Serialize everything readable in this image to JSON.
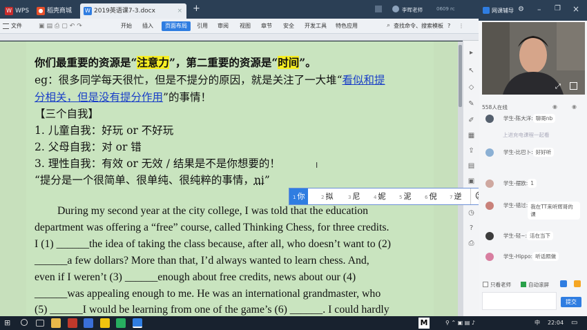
{
  "app": {
    "tabs": [
      {
        "label": "WPS",
        "icon": "wps-icon"
      },
      {
        "label": "稻壳商城",
        "icon": "daoke-icon"
      },
      {
        "label": "2019英语课7-3.docx",
        "icon": "doc-icon"
      }
    ],
    "new_tab": "+",
    "user": "李晖老师",
    "user_extra": "0609 rc"
  },
  "ribbon": {
    "file": "文件",
    "menus": [
      "开始",
      "插入",
      "页面布局",
      "引用",
      "审阅",
      "视图",
      "章节",
      "安全",
      "开发工具",
      "特色应用"
    ],
    "active_menu": "页面布局",
    "search": "查找命令、搜索模板",
    "help": "?"
  },
  "document": {
    "line1_a": "你们最重要的资源是“",
    "line1_hl1": "注意力",
    "line1_b": "”，第二重要的资源是“",
    "line1_hl2": "时间",
    "line1_c": "”。",
    "line2_a": "eg：很多同学每天很忙，但是不提分的原因，就是关注了一大堆“",
    "line2_link": "看似和提",
    "line3_link": "分相关，但是没有提分作用",
    "line3_b": "”的事情！",
    "line4": "【三个自我】",
    "line5": "1.  儿童自我：好玩 or 不好玩",
    "line6": "2.  父母自我：对 or 错",
    "line7": "3.  理性自我：有效 or 无效 / 结果是不是你想要的！",
    "line8_a": "“提分是一个很简单、很单纯、很纯粹的事情，",
    "line8_typing": "ni",
    "line8_b": "”",
    "para": [
      "During my second year at the city college, I was told that the education",
      "department was offering a “free” course, called Thinking Chess, for three credits.",
      "I (1) ______the idea of taking the class because, after all, who doesn’t want to (2)",
      "______a few dollars? More than that, I’d always wanted to learn chess. And,",
      "even if I weren’t (3) ______enough about free credits, news about our (4)",
      "______was appealing enough to me. He was an international grandmaster, who",
      "(5) ______I would be learning from one of the game’s (6) ______. I could hardly"
    ]
  },
  "ime": {
    "candidates": [
      {
        "n": "1",
        "c": "你"
      },
      {
        "n": "2",
        "c": "拟"
      },
      {
        "n": "3",
        "c": "尼"
      },
      {
        "n": "4",
        "c": "妮"
      },
      {
        "n": "5",
        "c": "泥"
      },
      {
        "n": "6",
        "c": "倪"
      },
      {
        "n": "7",
        "c": "逆"
      }
    ],
    "emoji": "☺"
  },
  "panel": {
    "title": "网课辅导",
    "online": "558人在线",
    "messages": [
      {
        "who": "学生-陈大洋:",
        "text": "聊哥nb"
      },
      {
        "who": "",
        "text": "上进充电课程一起看"
      },
      {
        "who": "学生-比巴卜:",
        "text": "好好听"
      },
      {
        "who": "学生-摆欧:",
        "text": "1"
      },
      {
        "who": "学生-错过:",
        "text": "我在TT来听辉哥的课"
      },
      {
        "who": "学生-轻~:",
        "text": "活在当下"
      },
      {
        "who": "学生-Hippo:",
        "text": "听话照做"
      }
    ],
    "only_teacher": "只看老师",
    "auto_scroll": "自动滚屏",
    "send": "提交"
  },
  "taskbar": {
    "lang": "中",
    "time": "22:04",
    "m": "M"
  },
  "colors": {
    "accent": "#2f7de1",
    "doc_bg": "#c9e4bf",
    "highlight": "#f6ee22",
    "link": "#1a3fc8"
  }
}
